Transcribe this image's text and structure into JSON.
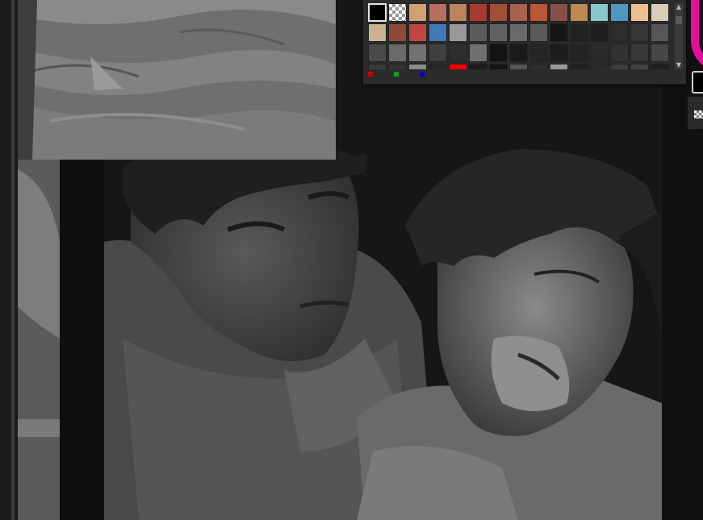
{
  "palette": {
    "swatches": [
      {
        "color": "#000000",
        "selected": true
      },
      {
        "color": "transparent"
      },
      {
        "color": "#d2a173"
      },
      {
        "color": "#b86f5f"
      },
      {
        "color": "#b9845e"
      },
      {
        "color": "#a83a33"
      },
      {
        "color": "#a34f38"
      },
      {
        "color": "#a7614d"
      },
      {
        "color": "#b8573a"
      },
      {
        "color": "#87514a"
      },
      {
        "color": "#bb8b52"
      },
      {
        "color": "#88c8cc"
      },
      {
        "color": "#4f96c4"
      },
      {
        "color": "#edc08f"
      },
      {
        "color": "#d9cdb7"
      },
      {
        "color": "#c9b391"
      },
      {
        "color": "#8f4a38"
      },
      {
        "color": "#c0473f"
      },
      {
        "color": "#4279b7"
      },
      {
        "color": "#9a9a9a"
      },
      {
        "color": "#5d5d5d"
      },
      {
        "color": "#626262"
      },
      {
        "color": "#6a6a6a"
      },
      {
        "color": "#5b5b5b"
      },
      {
        "color": "#161616"
      },
      {
        "color": "#222222"
      },
      {
        "color": "#202020"
      },
      {
        "color": "#2c2c2c"
      },
      {
        "color": "#363636"
      },
      {
        "color": "#575757"
      },
      {
        "color": "#4a4a4a"
      },
      {
        "color": "#6a6a6a"
      },
      {
        "color": "#727272"
      },
      {
        "color": "#404040"
      },
      {
        "color": "#2e2e2e"
      },
      {
        "color": "#707070"
      },
      {
        "color": "#131313"
      },
      {
        "color": "#1a1a1a"
      },
      {
        "color": "#262626"
      },
      {
        "color": "#1d1d1d"
      },
      {
        "color": "#242424"
      },
      {
        "color": "#2a2a2a"
      },
      {
        "color": "#323232"
      },
      {
        "color": "#383838"
      },
      {
        "color": "#474747"
      },
      {
        "color": "#3a3a3a"
      },
      {
        "color": "#333333"
      },
      {
        "color": "#8a8a8a"
      },
      {
        "color": "#262626"
      },
      {
        "color": "#ff0000"
      },
      {
        "color": "#1b1b1b"
      },
      {
        "color": "#151515"
      },
      {
        "color": "#565656"
      },
      {
        "color": "#2f2f2f"
      },
      {
        "color": "#9b9b9b"
      },
      {
        "color": "#202020"
      },
      {
        "color": "#2b2b2b"
      },
      {
        "color": "#3d3d3d"
      },
      {
        "color": "#444444"
      },
      {
        "color": "#1e1e1e"
      }
    ],
    "channel_colors": {
      "red": "#cc0000",
      "green": "#10a010",
      "blue": "#0000cc"
    }
  },
  "colors": {
    "accent_magenta": "#e0109a",
    "foreground_color": "#000000"
  },
  "icons": {
    "scroll_up": "▲",
    "scroll_down": "▼"
  }
}
